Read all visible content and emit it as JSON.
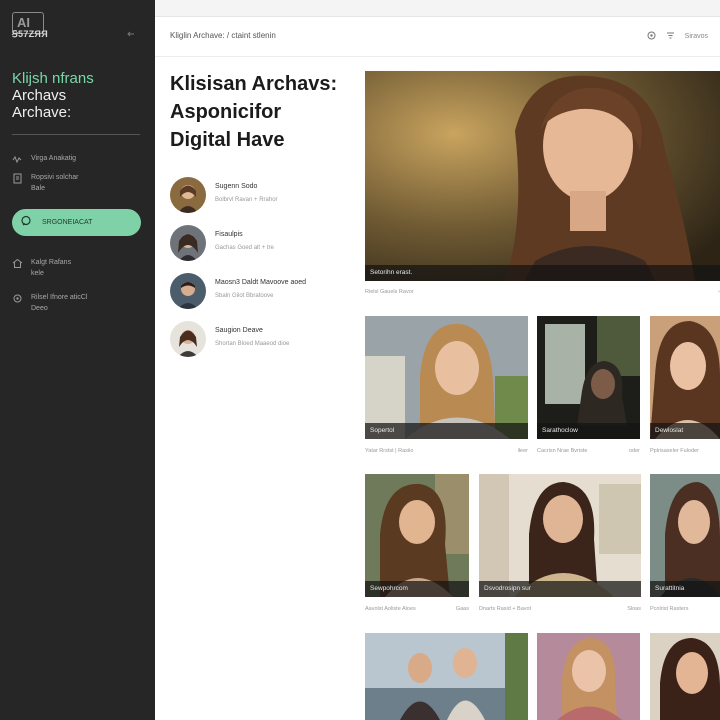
{
  "sidebar": {
    "logo_text": "AI",
    "brand": "Ꞩ57ZЯЯ",
    "title_line1": "Klijsh nfrans",
    "title_line2": "Archavs",
    "title_line3": "Archave:",
    "nav": [
      {
        "label": "Virga Anakatig",
        "sub": ""
      },
      {
        "label": "Ropsivi solchar",
        "sub": "Bale"
      },
      {
        "label": "Kalgt Rafans",
        "sub": "kele"
      },
      {
        "label": "Rilsel Ifnore aticCl",
        "sub": "Deeo"
      }
    ],
    "button_label": "SRGONEIACAT",
    "accent": "#7fd1a7"
  },
  "header": {
    "breadcrumb": "Kliglin Archave: / ctaint stlenin",
    "right_label": "Siravos"
  },
  "main": {
    "title_lines": [
      "Klisisan Archavs:",
      "Asponicifor",
      "Digital Have"
    ],
    "people": [
      {
        "name": "Sugenn Sodo",
        "meta": "Bolbrvl Ravan + Rrahor"
      },
      {
        "name": "Fisaulpis",
        "meta": "Gachas Goed alt + tre"
      },
      {
        "name": "Maosn3 Daldt Mavoove aoed",
        "meta": "Sbaln Gilot Bbratoove"
      },
      {
        "name": "Saugion Deave",
        "meta": "Shortan Bloed Maaeod dioe"
      }
    ],
    "hero_caption": "Setorihn erast.",
    "hero_meta": "Rielsl Gauels Ravor",
    "cards": [
      {
        "caption": "Sopertol",
        "meta": "Yatar Rrstst | Rasiio",
        "meta2": "ileer"
      },
      {
        "caption": "Sarathoclow",
        "meta": "Cacrisn Nrae Bvriste",
        "meta2": "oder"
      },
      {
        "caption": "Dewloslat",
        "meta": "Pplrisaseler Fuloder",
        "meta2": ""
      },
      {
        "caption": "Sewpohrcom",
        "meta": "Aavolst Aoliste Aloes",
        "meta2": "Gaas"
      },
      {
        "caption": "Dsvodrosipn sur",
        "meta": "Dnarts Rasid + Bavot",
        "meta2": "Sloas"
      },
      {
        "caption": "Surattitnia",
        "meta": "Pcolrist Rasters",
        "meta2": ""
      }
    ]
  }
}
